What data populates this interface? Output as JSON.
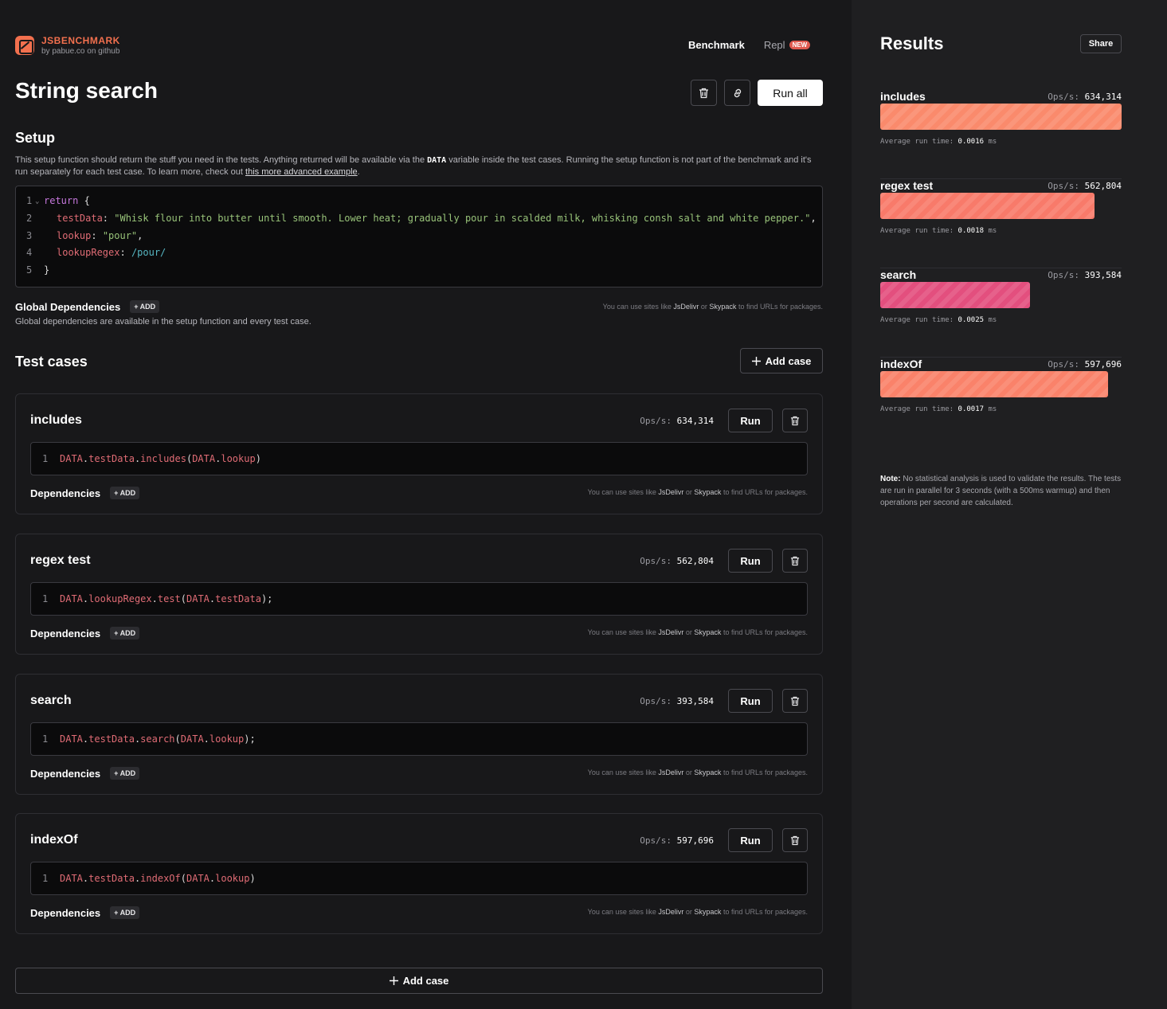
{
  "brand": {
    "name": "JSBENCHMARK",
    "sub": "by pabue.co on github"
  },
  "nav": {
    "benchmark": "Benchmark",
    "repl": "Repl",
    "repl_badge": "NEW"
  },
  "page_title": "String search",
  "toolbar": {
    "run_all": "Run all"
  },
  "setup": {
    "heading": "Setup",
    "desc_a": "This setup function should return the stuff you need in the tests. Anything returned will be available via the ",
    "desc_var": "DATA",
    "desc_b": " variable inside the test cases. Running the setup function is not part of the benchmark and it's run separately for each test case. To learn more, check out ",
    "desc_link": "this more advanced example",
    "desc_end": ".",
    "lines": {
      "n1": "1",
      "n2": "2",
      "n3": "3",
      "n4": "4",
      "n5": "5",
      "fold": "⌄",
      "l1_kw": "return",
      "l1_p": " {",
      "l2_key": "testData",
      "l2_colon": ": ",
      "l2_val": "\"Whisk flour into butter until smooth. Lower heat; gradually pour in scalded milk, whisking consh salt and white pepper.\"",
      "l2_comma": ",",
      "l3_key": "lookup",
      "l3_colon": ": ",
      "l3_val": "\"pour\"",
      "l3_comma": ",",
      "l4_key": "lookupRegex",
      "l4_colon": ": ",
      "l4_val": "/pour/",
      "l5_p": "}"
    }
  },
  "global_deps": {
    "label": "Global Dependencies",
    "add": "+ ADD",
    "desc": "Global dependencies are available in the setup function and every test case."
  },
  "hint": {
    "a": "You can use sites like ",
    "jsdelivr": "JsDelivr",
    "or": " or ",
    "skypack": "Skypack",
    "b": " to find URLs for packages."
  },
  "test_cases": {
    "heading": "Test cases",
    "add_case": "Add case",
    "ops_label": "Ops/s:",
    "run": "Run",
    "deps_label": "Dependencies",
    "deps_add": "+ ADD",
    "items": [
      {
        "name": "includes",
        "ops": "634,314",
        "ln": "1",
        "t1": "DATA",
        "t2": ".",
        "t3": "testData",
        "t4": ".",
        "t5": "includes",
        "t6": "(",
        "t7": "DATA",
        "t8": ".",
        "t9": "lookup",
        "t10": ")"
      },
      {
        "name": "regex test",
        "ops": "562,804",
        "ln": "1",
        "t1": "DATA",
        "t2": ".",
        "t3": "lookupRegex",
        "t4": ".",
        "t5": "test",
        "t6": "(",
        "t7": "DATA",
        "t8": ".",
        "t9": "testData",
        "t10": ");"
      },
      {
        "name": "search",
        "ops": "393,584",
        "ln": "1",
        "t1": "DATA",
        "t2": ".",
        "t3": "testData",
        "t4": ".",
        "t5": "search",
        "t6": "(",
        "t7": "DATA",
        "t8": ".",
        "t9": "lookup",
        "t10": ");"
      },
      {
        "name": "indexOf",
        "ops": "597,696",
        "ln": "1",
        "t1": "DATA",
        "t2": ".",
        "t3": "testData",
        "t4": ".",
        "t5": "indexOf",
        "t6": "(",
        "t7": "DATA",
        "t8": ".",
        "t9": "lookup",
        "t10": ")"
      }
    ]
  },
  "results": {
    "title": "Results",
    "share": "Share",
    "ops_label": "Ops/s:",
    "avg_label": "Average run time:",
    "avg_unit": "ms",
    "max_ops": 634314,
    "items": [
      {
        "name": "includes",
        "ops": "634,314",
        "ops_value": 634314,
        "avg": "0.0016",
        "color": "#fa8a6c"
      },
      {
        "name": "regex test",
        "ops": "562,804",
        "ops_value": 562804,
        "avg": "0.0018",
        "color": "#f87a6a"
      },
      {
        "name": "search",
        "ops": "393,584",
        "ops_value": 393584,
        "avg": "0.0025",
        "color": "#e34f7e"
      },
      {
        "name": "indexOf",
        "ops": "597,696",
        "ops_value": 597696,
        "avg": "0.0017",
        "color": "#fa826a"
      }
    ],
    "note_bold": "Note:",
    "note_text": " No statistical analysis is used to validate the results. The tests are run in parallel for 3 seconds (with a 500ms warmup) and then operations per second are calculated."
  },
  "bottom": {
    "add_case": "Add case"
  },
  "colors": {
    "accent": "#f2704e",
    "bar_includes": "#fa8a6c",
    "bar_regex": "#f87a6a",
    "bar_search": "#e34f7e",
    "bar_indexof": "#fa826a"
  },
  "icons": {
    "trash": "trash-icon",
    "link": "link-icon",
    "plus": "plus-icon"
  }
}
